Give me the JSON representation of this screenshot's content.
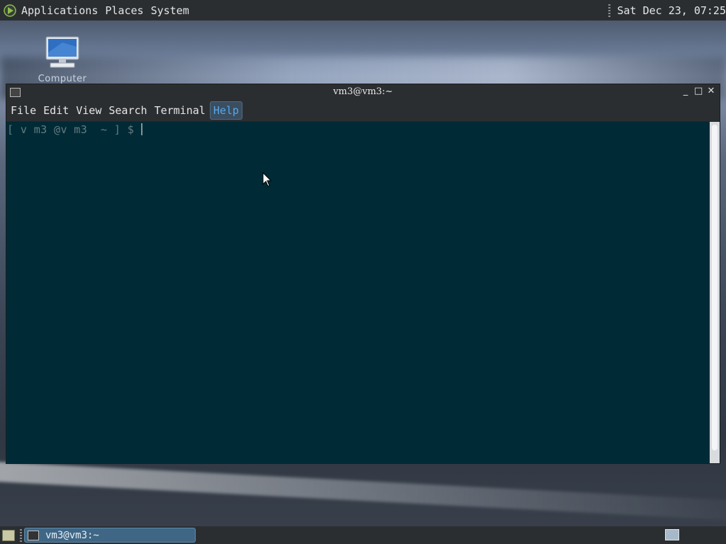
{
  "top_panel": {
    "menus": [
      "Applications",
      "Places",
      "System"
    ],
    "clock": "Sat Dec 23, 07:25"
  },
  "desktop": {
    "icons": [
      {
        "label": "Computer",
        "icon": "computer-icon"
      }
    ]
  },
  "window": {
    "title": "vm3@vm3:~",
    "menu": [
      "File",
      "Edit",
      "View",
      "Search",
      "Terminal",
      "Help"
    ],
    "active_menu": "Help"
  },
  "terminal": {
    "prompt": "[ v m3 @v m3  ~ ] $"
  },
  "bottom_panel": {
    "tasks": [
      {
        "label": "vm3@vm3:~"
      }
    ]
  },
  "colors": {
    "panel": "#2b2e31",
    "terminal_bg": "#002b36",
    "terminal_fg": "#657b83",
    "accent": "#5aa6e6",
    "task_active": "#3f6785"
  }
}
